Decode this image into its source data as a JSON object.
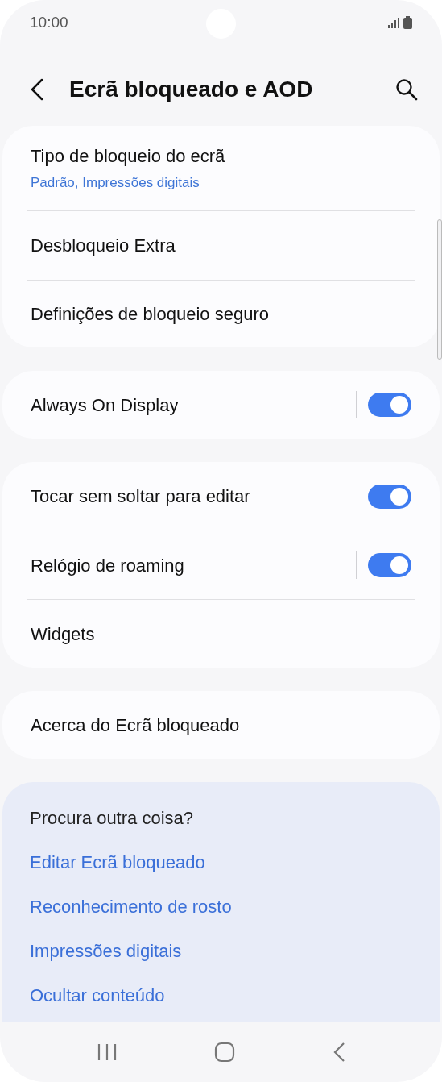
{
  "status_bar": {
    "time": "10:00"
  },
  "header": {
    "title": "Ecrã bloqueado e AOD"
  },
  "groups": [
    {
      "items": [
        {
          "title": "Tipo de bloqueio do ecrã",
          "subtitle": "Padrão, Impressões digitais"
        },
        {
          "title": "Desbloqueio Extra"
        },
        {
          "title": "Definições de bloqueio seguro"
        }
      ]
    },
    {
      "items": [
        {
          "title": "Always On Display",
          "split": true,
          "on": true
        }
      ]
    },
    {
      "items": [
        {
          "title": "Tocar sem soltar para editar",
          "split": false,
          "on": true
        },
        {
          "title": "Relógio de roaming",
          "split": true,
          "on": true
        },
        {
          "title": "Widgets"
        }
      ]
    },
    {
      "items": [
        {
          "title": "Acerca do Ecrã bloqueado"
        }
      ]
    }
  ],
  "suggestions": {
    "title": "Procura outra coisa?",
    "links": [
      "Editar Ecrã bloqueado",
      "Reconhecimento de rosto",
      "Impressões digitais",
      "Ocultar conteúdo"
    ]
  }
}
